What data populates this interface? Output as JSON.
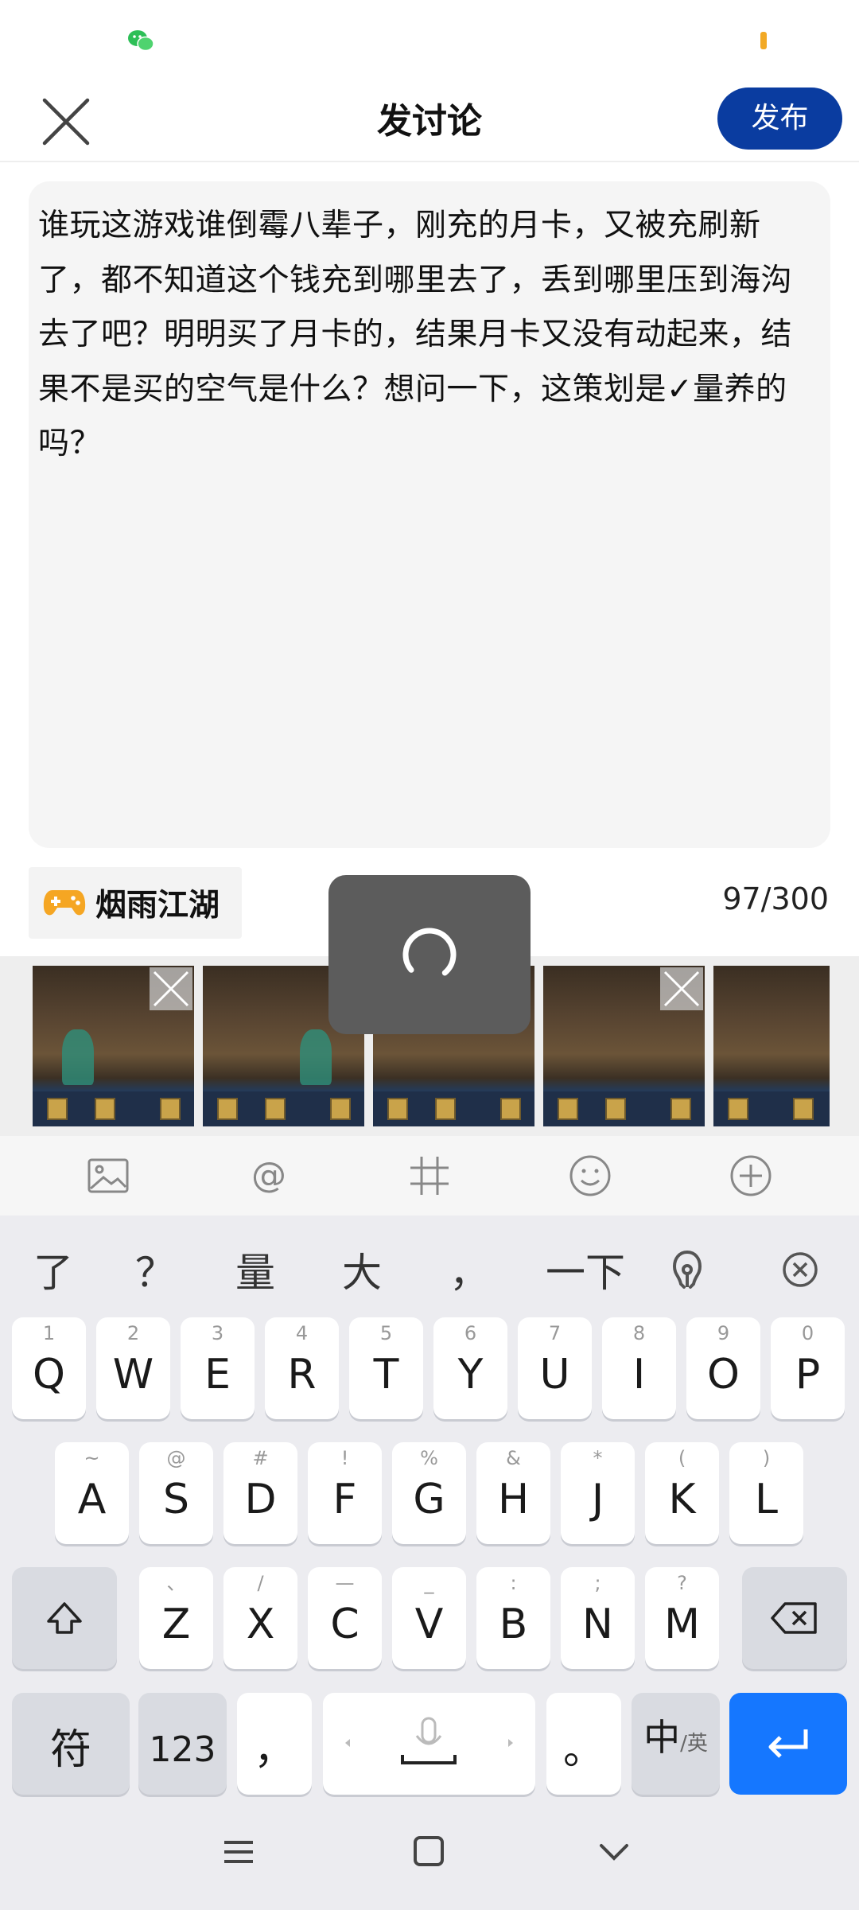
{
  "header": {
    "title": "发讨论",
    "publish_label": "发布"
  },
  "editor": {
    "text": "谁玩这游戏谁倒霉八辈子，刚充的月卡，又被充刷新了，都不知道这个钱充到哪里去了，丢到哪里压到海沟去了吧？明明买了月卡的，结果月卡又没有动起来，结果不是买的空气是什么？想问一下，这策划是✓量养的吗？"
  },
  "game_tag": {
    "name": "烟雨江湖",
    "icon": "gamepad-icon"
  },
  "counter": "97/300",
  "toolbar": {
    "icons": [
      "image-icon",
      "at-icon",
      "hashtag-icon",
      "emoji-icon",
      "plus-circle-icon"
    ]
  },
  "candidates": [
    "了",
    "？",
    "量",
    "大",
    "，",
    "一下"
  ],
  "keyboard": {
    "row1": [
      {
        "k": "Q",
        "h": "1"
      },
      {
        "k": "W",
        "h": "2"
      },
      {
        "k": "E",
        "h": "3"
      },
      {
        "k": "R",
        "h": "4"
      },
      {
        "k": "T",
        "h": "5"
      },
      {
        "k": "Y",
        "h": "6"
      },
      {
        "k": "U",
        "h": "7"
      },
      {
        "k": "I",
        "h": "8"
      },
      {
        "k": "O",
        "h": "9"
      },
      {
        "k": "P",
        "h": "0"
      }
    ],
    "row2": [
      {
        "k": "A",
        "h": "~"
      },
      {
        "k": "S",
        "h": "@"
      },
      {
        "k": "D",
        "h": "#"
      },
      {
        "k": "F",
        "h": "!"
      },
      {
        "k": "G",
        "h": "%"
      },
      {
        "k": "H",
        "h": "&"
      },
      {
        "k": "J",
        "h": "*"
      },
      {
        "k": "K",
        "h": "("
      },
      {
        "k": "L",
        "h": ")"
      }
    ],
    "row3": [
      {
        "k": "Z",
        "h": "、"
      },
      {
        "k": "X",
        "h": "/"
      },
      {
        "k": "C",
        "h": "—"
      },
      {
        "k": "V",
        "h": "_"
      },
      {
        "k": "B",
        "h": ":"
      },
      {
        "k": "N",
        "h": ";"
      },
      {
        "k": "M",
        "h": "?"
      }
    ],
    "symbol_label": "符",
    "num_label": "123",
    "comma": "，",
    "period": "。",
    "lang_main": "中",
    "lang_sub": "/英"
  }
}
